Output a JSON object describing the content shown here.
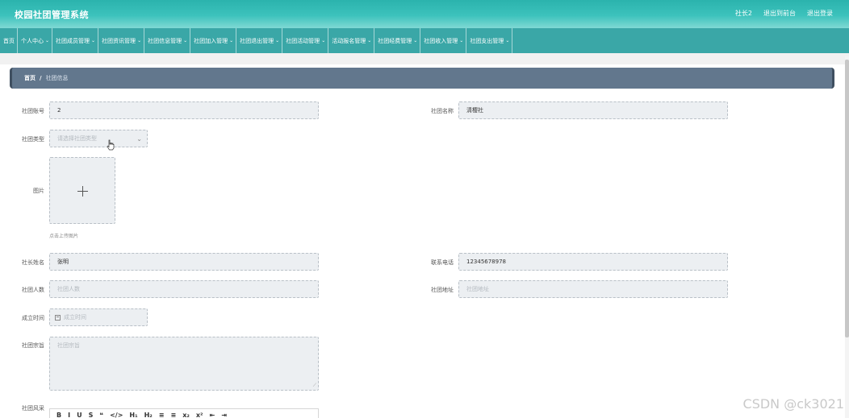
{
  "app": {
    "title": "校园社团管理系统"
  },
  "top_actions": {
    "user": "社长2",
    "backend": "退出到前台",
    "logout": "退出登录"
  },
  "nav": {
    "items": [
      "首页",
      "个人中心",
      "社团成员管理",
      "社团资讯管理",
      "社团信息管理",
      "社团加入管理",
      "社团退出管理",
      "社团活动管理",
      "活动报名管理",
      "社团经费管理",
      "社团收入管理",
      "社团支出管理"
    ],
    "has_dropdown": [
      false,
      true,
      true,
      true,
      true,
      true,
      true,
      true,
      true,
      true,
      true,
      true
    ]
  },
  "breadcrumb": {
    "home": "首页",
    "separator": "/",
    "current": "社团信息"
  },
  "form": {
    "club_account": {
      "label": "社团账号",
      "value": "2"
    },
    "club_name": {
      "label": "社团名称",
      "value": "清樱社"
    },
    "club_type": {
      "label": "社团类型",
      "placeholder": "请选择社团类型"
    },
    "picture": {
      "label": "图片",
      "hint": "点击上传图片"
    },
    "leader_name": {
      "label": "社长姓名",
      "value": "张明"
    },
    "phone": {
      "label": "联系电话",
      "value": "12345678978"
    },
    "member_count": {
      "label": "社团人数",
      "placeholder": "社团人数"
    },
    "address": {
      "label": "社团地址",
      "placeholder": "社团地址"
    },
    "founded": {
      "label": "成立时间",
      "placeholder": "成立时间"
    },
    "purpose": {
      "label": "社团宗旨",
      "placeholder": "社团宗旨"
    },
    "style": {
      "label": "社团风采"
    }
  },
  "editor_toolbar": [
    "B",
    "I",
    "U",
    "S",
    "❝",
    "</>",
    "H₁",
    "H₂",
    "≡",
    "≡",
    "x₂",
    "x²",
    "⇤",
    "⇥"
  ],
  "watermark": "CSDN @ck3021",
  "colors": {
    "header": "#3cc2bc",
    "nav": "#3aa7a7",
    "breadcrumb": "#62778d",
    "field_bg": "#eceff2"
  }
}
